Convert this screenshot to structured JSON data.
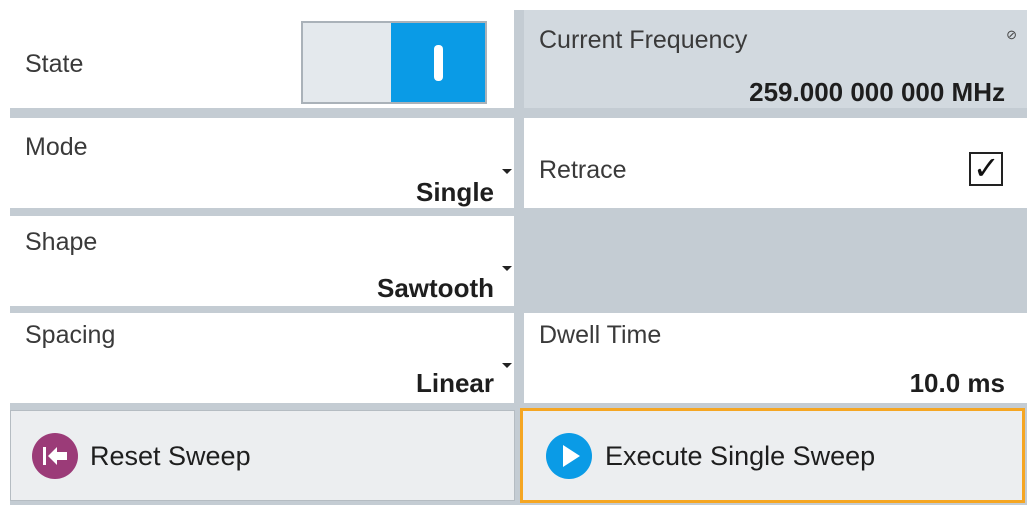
{
  "state": {
    "label": "State",
    "toggle_on": true
  },
  "current_frequency": {
    "label": "Current Frequency",
    "value": "259.000 000 000 MHz",
    "badge": "⊘"
  },
  "mode": {
    "label": "Mode",
    "value": "Single"
  },
  "retrace": {
    "label": "Retrace",
    "checked": true,
    "check_glyph": "✓"
  },
  "shape": {
    "label": "Shape",
    "value": "Sawtooth"
  },
  "spacing": {
    "label": "Spacing",
    "value": "Linear"
  },
  "dwell_time": {
    "label": "Dwell Time",
    "value": "10.0 ms"
  },
  "buttons": {
    "reset": {
      "label": "Reset Sweep",
      "icon": "reset-arrow-icon",
      "icon_color": "#9b3b78"
    },
    "execute": {
      "label": "Execute Single Sweep",
      "icon": "play-icon",
      "icon_color": "#0a9be6"
    }
  },
  "colors": {
    "accent": "#0a9be6",
    "focus": "#f5a623",
    "grid": "#c4ccd3"
  }
}
